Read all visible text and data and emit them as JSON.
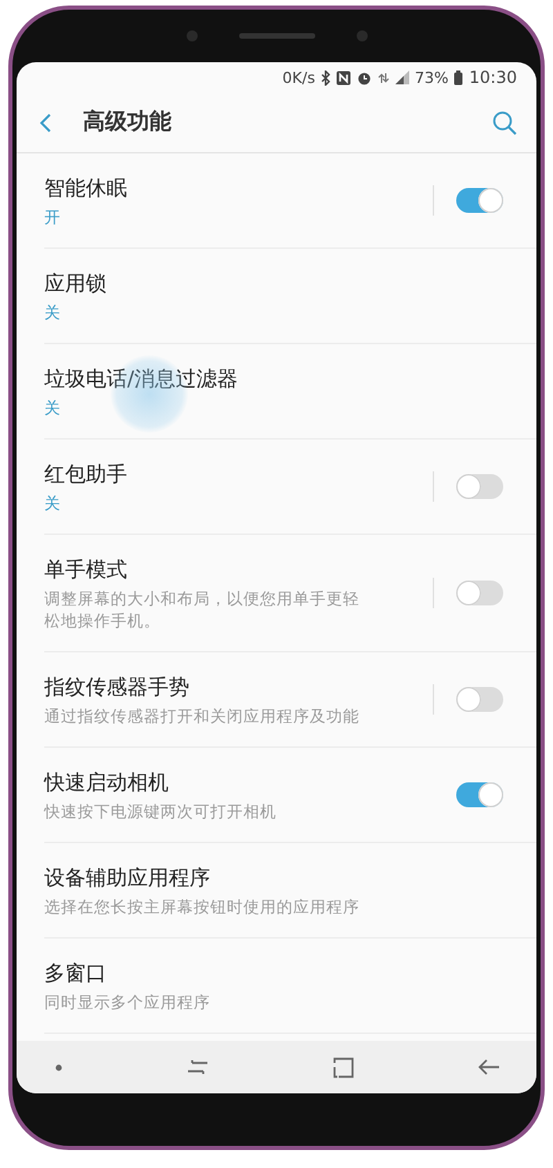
{
  "status_bar": {
    "speed": "0K/s",
    "battery": "73%",
    "time": "10:30"
  },
  "header": {
    "title": "高级功能"
  },
  "settings": [
    {
      "title": "智能休眠",
      "status": "开",
      "kind": "divided-switch",
      "on": true
    },
    {
      "title": "应用锁",
      "status": "关",
      "kind": "plain"
    },
    {
      "title": "垃圾电话/消息过滤器",
      "status": "关",
      "kind": "plain",
      "touched": true
    },
    {
      "title": "红包助手",
      "status": "关",
      "kind": "divided-switch",
      "on": false
    },
    {
      "title": "单手模式",
      "description": "调整屏幕的大小和布局，以便您用单手更轻松地操作手机。",
      "kind": "divided-switch",
      "on": false
    },
    {
      "title": "指纹传感器手势",
      "description": "通过指纹传感器打开和关闭应用程序及功能",
      "kind": "divided-switch",
      "on": false
    },
    {
      "title": "快速启动相机",
      "description": "快速按下电源键两次可打开相机",
      "kind": "switch",
      "on": true
    },
    {
      "title": "设备辅助应用程序",
      "description": "选择在您长按主屏幕按钮时使用的应用程序",
      "kind": "plain"
    },
    {
      "title": "多窗口",
      "description": "同时显示多个应用程序",
      "kind": "plain"
    }
  ]
}
